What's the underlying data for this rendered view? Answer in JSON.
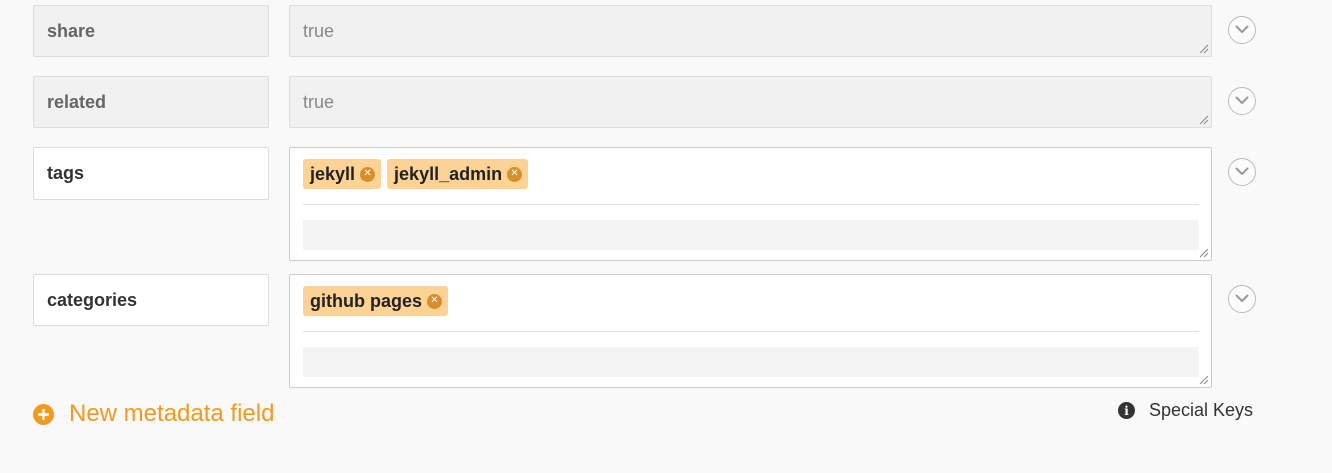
{
  "fields": [
    {
      "key": "share",
      "value": "true"
    },
    {
      "key": "related",
      "value": "true"
    },
    {
      "key": "tags",
      "tags": [
        "jekyll",
        "jekyll_admin"
      ]
    },
    {
      "key": "categories",
      "tags": [
        "github pages"
      ]
    }
  ],
  "footer": {
    "new_field_label": "New metadata field",
    "special_keys_label": "Special Keys"
  },
  "icons": {
    "collapse": "chevron-down-icon",
    "remove_tag": "close-icon",
    "add": "plus-circle-icon",
    "info": "info-icon"
  },
  "colors": {
    "accent": "#f39a1e",
    "tag_bg": "#fcd394",
    "tag_remove": "#d98e2c"
  }
}
